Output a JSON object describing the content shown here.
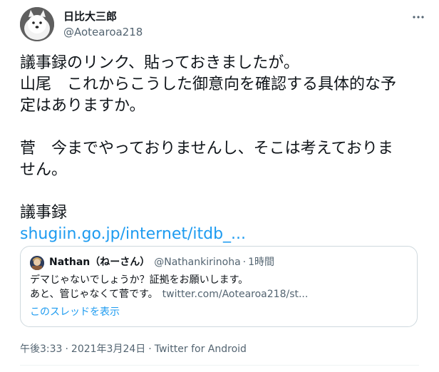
{
  "author": {
    "display_name": "日比大三郎",
    "handle": "@Aotearoa218",
    "avatar_icon": "samoyed-dog-avatar"
  },
  "tweet": {
    "lines": [
      "議事録のリンク、貼っておきましたが。",
      "山尾　これからこうした御意向を確認する具体的な予",
      "定はありますか。",
      "菅　今までやっておりませんし、そこは考えておりま",
      "せん。",
      "議事録"
    ],
    "link_text": "shugiin.go.jp/internet/itdb_..."
  },
  "quote": {
    "name": "Nathan（ねーさん）",
    "handle": "@Nathankirinoha",
    "separator": "·",
    "time": "1時間",
    "text_line1": "デマじゃないでしょうか？証拠をお願いします。",
    "text_line2": "あと、管じゃなくて菅です。",
    "link_text": "twitter.com/Aotearoa218/st...",
    "show_thread": "このスレッドを表示"
  },
  "meta": {
    "time": "午後3:33",
    "separator": "·",
    "date": "2021年3月24日",
    "source": "Twitter for Android"
  },
  "colors": {
    "link": "#1d9bf0",
    "secondary_text": "#536471",
    "border": "#cfd9de"
  }
}
